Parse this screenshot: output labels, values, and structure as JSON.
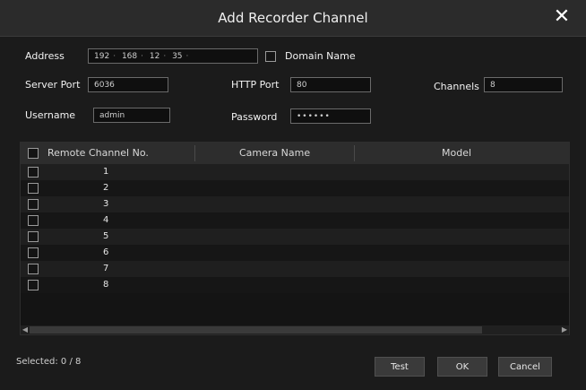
{
  "dialog": {
    "title": "Add Recorder Channel",
    "close_glyph": "✕"
  },
  "form": {
    "address_label": "Address",
    "address_octets": [
      "192",
      "168",
      "12",
      "35"
    ],
    "domain_name_label": "Domain Name",
    "server_port_label": "Server Port",
    "server_port_value": "6036",
    "http_port_label": "HTTP Port",
    "http_port_value": "80",
    "channels_label": "Channels",
    "channels_value": "8",
    "username_label": "Username",
    "username_value": "admin",
    "password_label": "Password",
    "password_value": "••••••"
  },
  "table": {
    "columns": [
      "Remote Channel No.",
      "Camera Name",
      "Model"
    ],
    "rows": [
      "1",
      "2",
      "3",
      "4",
      "5",
      "6",
      "7",
      "8"
    ]
  },
  "footer": {
    "selected_text": "Selected: 0 / 8",
    "test_label": "Test",
    "ok_label": "OK",
    "cancel_label": "Cancel"
  }
}
